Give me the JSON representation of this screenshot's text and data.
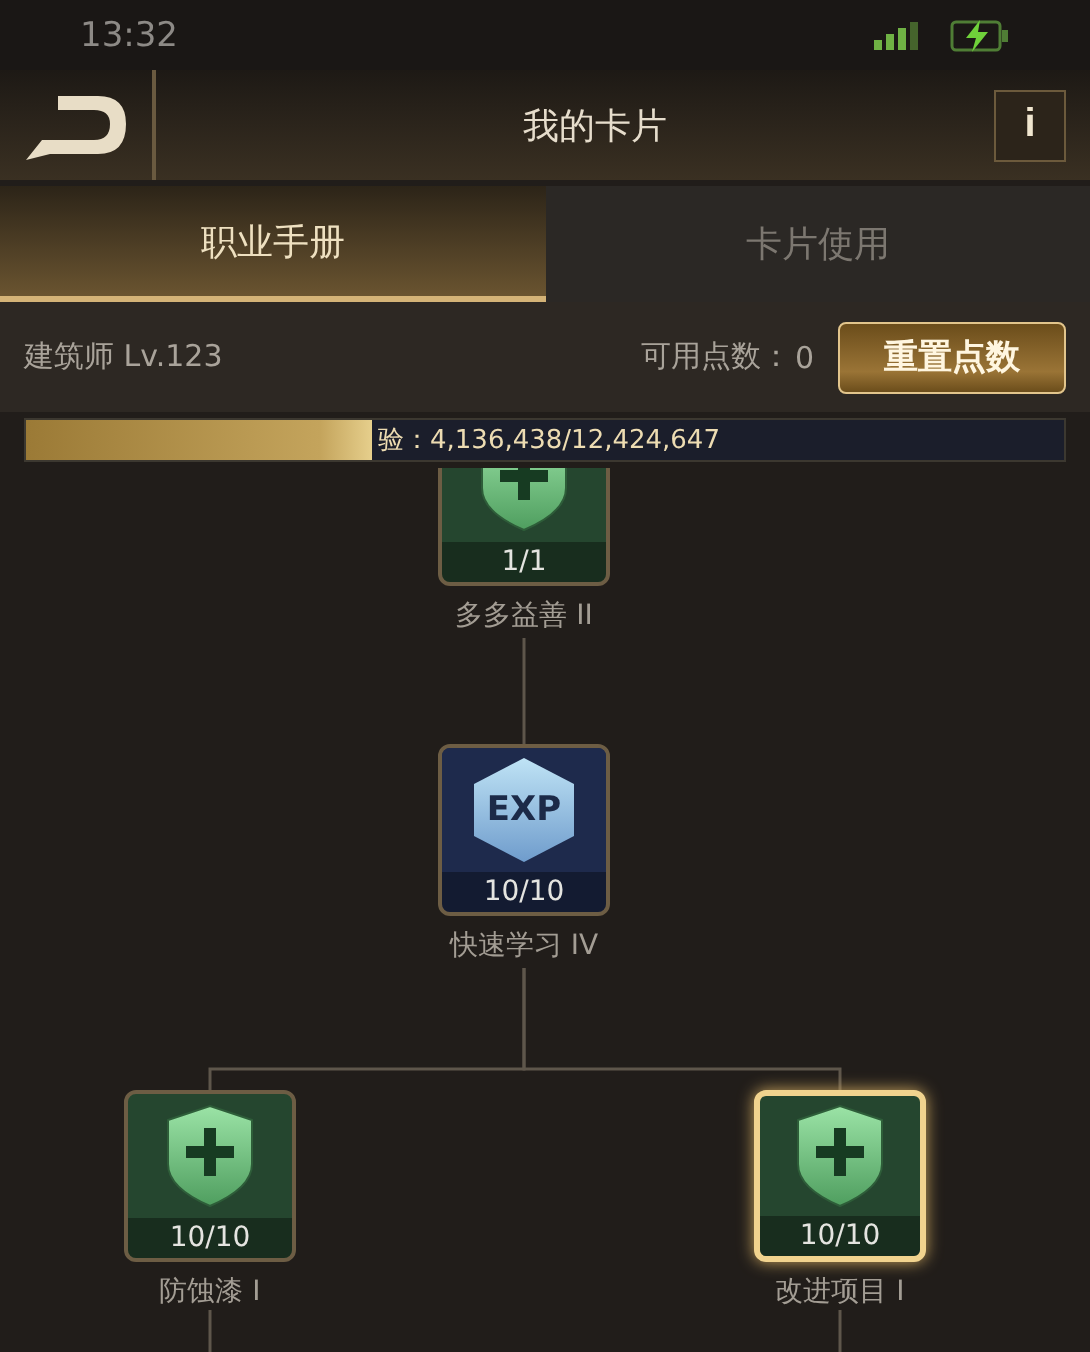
{
  "status_bar": {
    "time": "13:32"
  },
  "header": {
    "title": "我的卡片",
    "info_button": "i"
  },
  "tabs": [
    {
      "label": "职业手册",
      "selected": true
    },
    {
      "label": "卡片使用",
      "selected": false
    }
  ],
  "profile": {
    "class_level": "建筑师 Lv.123",
    "points_label": "可用点数：",
    "points": "0",
    "reset_button": "重置点数"
  },
  "experience": {
    "label": "验：4,136,438/12,424,647",
    "level": 0.333
  },
  "skill_tree": {
    "name": "多多益善 II",
    "count": "1/1",
    "kind": "shield",
    "selected": false,
    "children": [
      {
        "name": "快速学习 IV",
        "count": "10/10",
        "kind": "exp",
        "icon_text": "EXP",
        "selected": false,
        "children": [
          {
            "name": "防蚀漆 I",
            "count": "10/10",
            "kind": "shield",
            "selected": false
          },
          {
            "name": "改进项目 I",
            "count": "10/10",
            "kind": "shield",
            "selected": true
          }
        ]
      }
    ]
  }
}
